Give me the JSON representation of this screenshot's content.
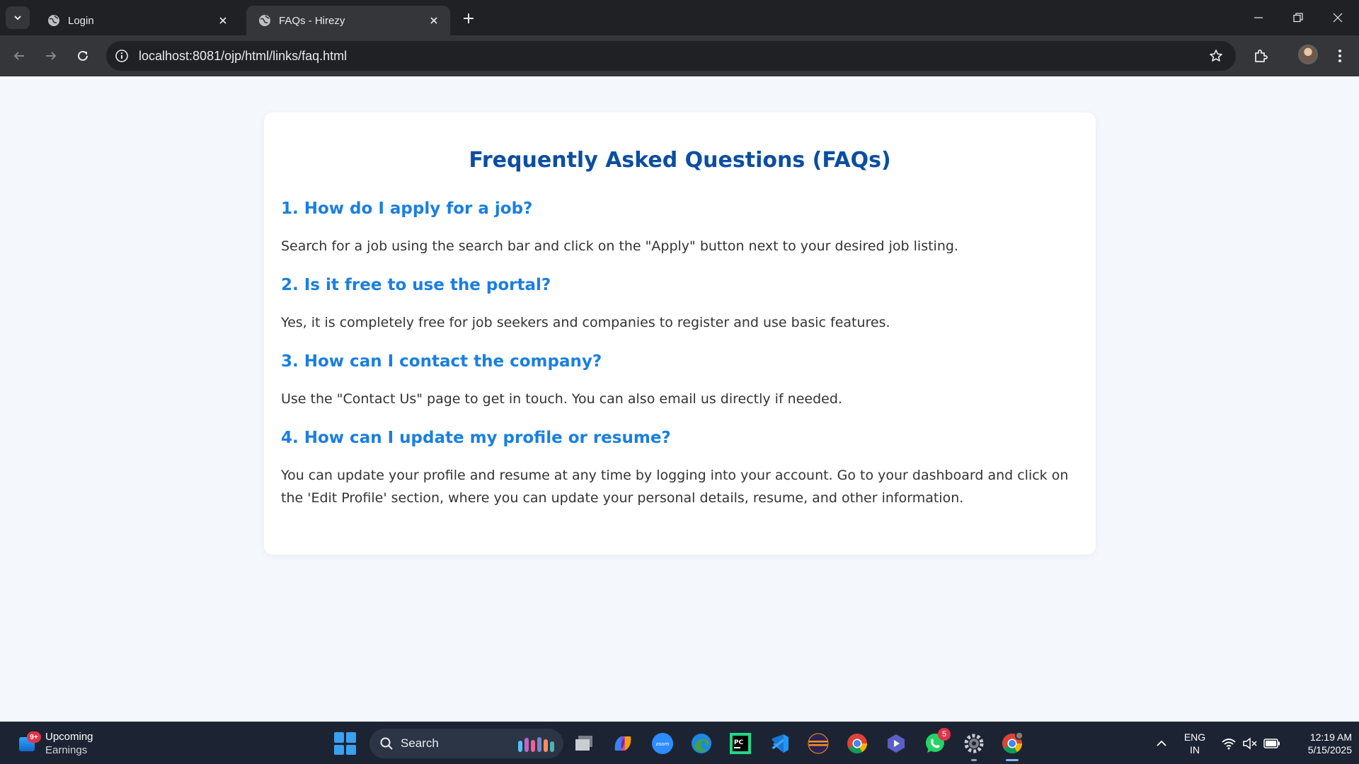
{
  "browser": {
    "tabs": [
      {
        "title": "Login",
        "active": false
      },
      {
        "title": "FAQs - Hirezy",
        "active": true
      }
    ],
    "url": "localhost:8081/ojp/html/links/faq.html"
  },
  "page": {
    "heading": "Frequently Asked Questions (FAQs)",
    "faqs": [
      {
        "question": "1. How do I apply for a job?",
        "answer": "Search for a job using the search bar and click on the \"Apply\" button next to your desired job listing."
      },
      {
        "question": "2. Is it free to use the portal?",
        "answer": "Yes, it is completely free for job seekers and companies to register and use basic features."
      },
      {
        "question": "3. How can I contact the company?",
        "answer": "Use the \"Contact Us\" page to get in touch. You can also email us directly if needed."
      },
      {
        "question": "4. How can I update my profile or resume?",
        "answer": "You can update your profile and resume at any time by logging into your account. Go to your dashboard and click on the 'Edit Profile' section, where you can update your personal details, resume, and other information."
      }
    ],
    "colors": {
      "heading": "#0b4ea2",
      "question": "#1a7fe0",
      "answer": "#333333",
      "background": "#f4f8fd"
    }
  },
  "taskbar": {
    "widget": {
      "badge": "9+",
      "title": "Upcoming",
      "subtitle": "Earnings"
    },
    "search_label": "Search",
    "apps": [
      "file-explorer-icon",
      "copilot-icon",
      "zoom-icon",
      "edge-icon",
      "pycharm-icon",
      "vscode-icon",
      "eclipse-icon",
      "chrome-icon",
      "clipchamp-icon",
      "whatsapp-icon",
      "settings-icon",
      "chrome-profile-icon"
    ],
    "whatsapp_count": "5",
    "zoom_label": "zoom",
    "pycharm_label": "PC",
    "language": {
      "line1": "ENG",
      "line2": "IN"
    },
    "clock": {
      "time": "12:19 AM",
      "date": "5/15/2025"
    }
  }
}
